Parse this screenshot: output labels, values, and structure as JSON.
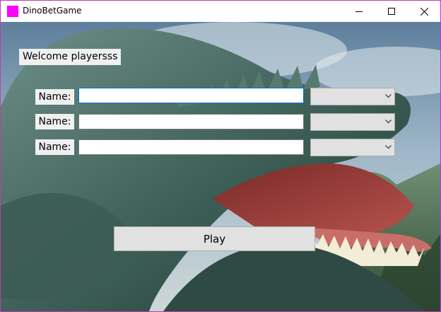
{
  "window": {
    "title": "DinoBetGame",
    "icon_color": "#ff00ff",
    "border_color": "#c239b3"
  },
  "title_controls": [
    "minimize-icon",
    "maximize-icon",
    "close-icon"
  ],
  "background": {
    "scene_icon": "dinosaur-background-image"
  },
  "welcome_text": "Welcome playersss",
  "players": [
    {
      "label": "Name:",
      "value": "",
      "bet_selected": ""
    },
    {
      "label": "Name:",
      "value": "",
      "bet_selected": ""
    },
    {
      "label": "Name:",
      "value": "",
      "bet_selected": ""
    }
  ],
  "play_label": "Play",
  "focus_color": "#0078d7"
}
